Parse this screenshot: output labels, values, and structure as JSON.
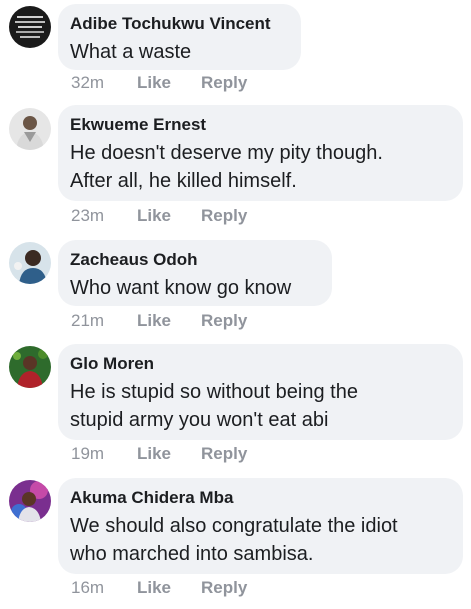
{
  "comments": [
    {
      "author": "Adibe Tochukwu Vincent",
      "text": "What a waste",
      "time": "32m",
      "like_label": "Like",
      "reply_label": "Reply",
      "avatar_icon": "profile-photo-icon"
    },
    {
      "author": "Ekwueme Ernest",
      "text": "He doesn't deserve my pity though.\nAfter all, he killed himself.",
      "time": "23m",
      "like_label": "Like",
      "reply_label": "Reply",
      "avatar_icon": "profile-photo-icon"
    },
    {
      "author": "Zacheaus Odoh",
      "text": "Who want know go know",
      "time": "21m",
      "like_label": "Like",
      "reply_label": "Reply",
      "avatar_icon": "profile-photo-icon"
    },
    {
      "author": "Glo Moren",
      "text": "He is stupid so without being  the\nstupid  army you won't  eat abi",
      "time": "19m",
      "like_label": "Like",
      "reply_label": "Reply",
      "avatar_icon": "profile-photo-icon"
    },
    {
      "author": "Akuma Chidera Mba",
      "text": "We should also congratulate the idiot\nwho marched into sambisa.",
      "time": "16m",
      "like_label": "Like",
      "reply_label": "Reply",
      "avatar_icon": "profile-photo-icon"
    }
  ],
  "colors": {
    "bubble": "#f0f2f5",
    "text": "#1c1e21",
    "meta": "#90949c"
  }
}
